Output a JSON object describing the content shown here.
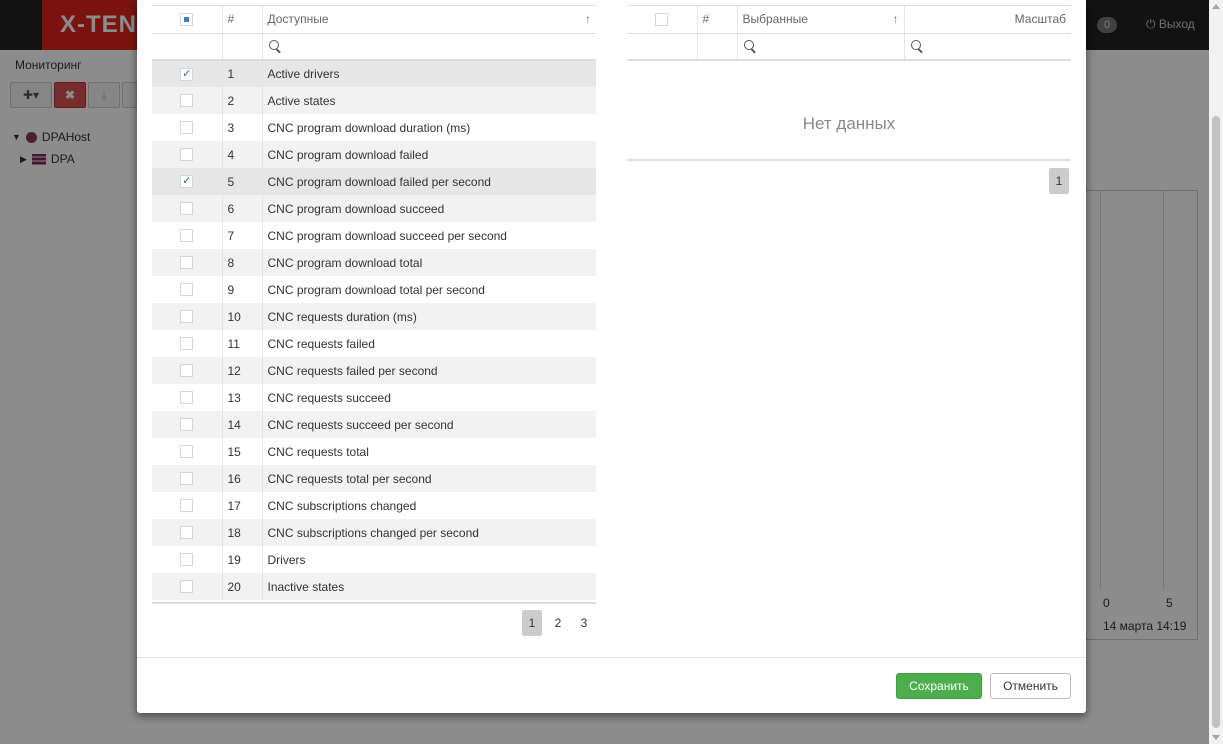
{
  "app": {
    "logo_text": "X-TEN",
    "notification_count": "0",
    "logout_label": "Выход",
    "section_title": "Мониторинг",
    "tree": [
      {
        "label": "DPAHost"
      },
      {
        "label": "DPA"
      }
    ],
    "chart_ticks": [
      "0",
      "5"
    ],
    "chart_timestamp": "14 марта 14:19"
  },
  "dialog": {
    "available": {
      "columns": {
        "number": "#",
        "name": "Доступные"
      },
      "rows": [
        {
          "n": "1",
          "name": "Active drivers",
          "checked": true
        },
        {
          "n": "2",
          "name": "Active states",
          "checked": false
        },
        {
          "n": "3",
          "name": "CNC program download duration (ms)",
          "checked": false
        },
        {
          "n": "4",
          "name": "CNC program download failed",
          "checked": false
        },
        {
          "n": "5",
          "name": "CNC program download failed per second",
          "checked": true
        },
        {
          "n": "6",
          "name": "CNC program download succeed",
          "checked": false
        },
        {
          "n": "7",
          "name": "CNC program download succeed per second",
          "checked": false
        },
        {
          "n": "8",
          "name": "CNC program download total",
          "checked": false
        },
        {
          "n": "9",
          "name": "CNC program download total per second",
          "checked": false
        },
        {
          "n": "10",
          "name": "CNC requests duration (ms)",
          "checked": false
        },
        {
          "n": "11",
          "name": "CNC requests failed",
          "checked": false
        },
        {
          "n": "12",
          "name": "CNC requests failed per second",
          "checked": false
        },
        {
          "n": "13",
          "name": "CNC requests succeed",
          "checked": false
        },
        {
          "n": "14",
          "name": "CNC requests succeed per second",
          "checked": false
        },
        {
          "n": "15",
          "name": "CNC requests total",
          "checked": false
        },
        {
          "n": "16",
          "name": "CNC requests total per second",
          "checked": false
        },
        {
          "n": "17",
          "name": "CNC subscriptions changed",
          "checked": false
        },
        {
          "n": "18",
          "name": "CNC subscriptions changed per second",
          "checked": false
        },
        {
          "n": "19",
          "name": "Drivers",
          "checked": false
        },
        {
          "n": "20",
          "name": "Inactive states",
          "checked": false
        }
      ],
      "pages": [
        "1",
        "2",
        "3"
      ],
      "active_page": "1"
    },
    "selected": {
      "columns": {
        "number": "#",
        "name": "Выбранные",
        "scale": "Масштаб"
      },
      "empty_text": "Нет данных",
      "pages": [
        "1"
      ],
      "active_page": "1"
    },
    "save_label": "Сохранить",
    "cancel_label": "Отменить"
  }
}
